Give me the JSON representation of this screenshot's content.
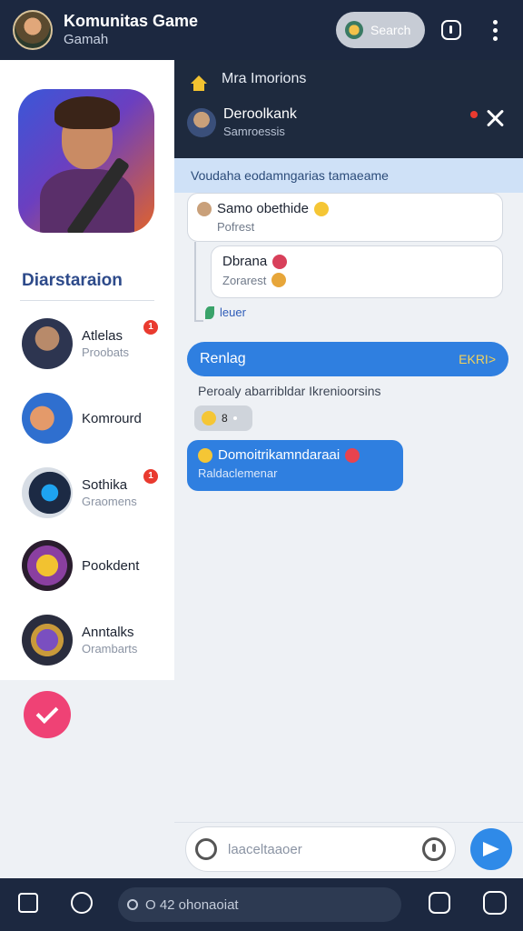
{
  "header": {
    "title": "Komunitas Game",
    "subtitle": "Gamah",
    "search_label": "Search",
    "icons": [
      "player-avatar",
      "search-icon",
      "info-icon",
      "more-icon"
    ]
  },
  "sidebar": {
    "section_label": "Diarstaraion",
    "friends": [
      {
        "name": "Atlelas",
        "status": "Proobats",
        "badge": "1"
      },
      {
        "name": "Komrourd",
        "status": ""
      },
      {
        "name": "Sothika",
        "status": "Graomens",
        "badge": "1"
      },
      {
        "name": "Pookdent",
        "status": ""
      },
      {
        "name": "Anntalks",
        "status": "Orambarts"
      }
    ]
  },
  "chat": {
    "breadcrumb": "Mra Imorions",
    "contact_name": "Deroolkank",
    "contact_sub": "Samroessis",
    "notice": "Voudaha eodamngarias tamaeame",
    "messages": [
      {
        "title": "Samo obethide",
        "sub": "Pofrest"
      },
      {
        "title": "Dbrana",
        "sub": "Zorarest"
      }
    ],
    "level_text": "leuer",
    "reply_label": "Renlag",
    "reply_tag": "EKRI>",
    "info_line": "Peroaly abarribldar Ikrenioorsins",
    "reaction_count": "8",
    "bubble_line1": "Domoitrikamndaraai",
    "bubble_line2": "Raldaclemenar"
  },
  "composer": {
    "placeholder": "laaceltaaoer"
  },
  "bottom_nav": {
    "search_text": "O 42 ohonaoiat"
  },
  "colors": {
    "topbar": "#1c2840",
    "accent_blue": "#2f7fe0",
    "badge_red": "#e93a2f",
    "fab_pink": "#ef4275"
  }
}
